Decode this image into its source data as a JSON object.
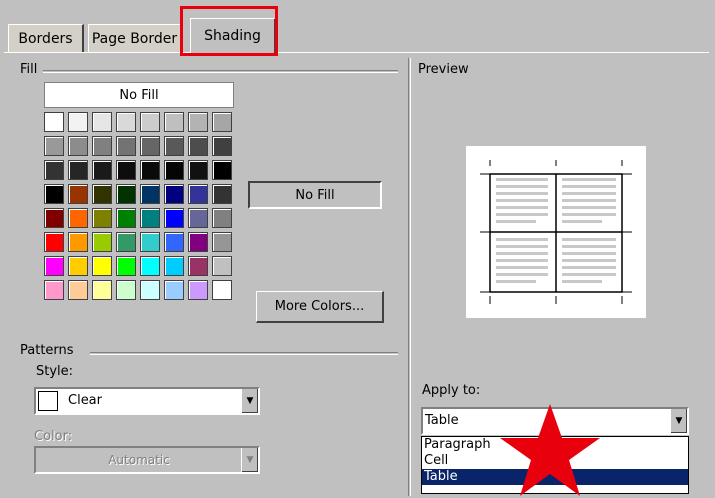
{
  "tabs": [
    {
      "label": "Borders",
      "active": false
    },
    {
      "label": "Page Border",
      "active": false
    },
    {
      "label": "Shading",
      "active": true
    }
  ],
  "fill": {
    "group_label": "Fill",
    "no_fill_label": "No Fill",
    "selected_name": "No Fill",
    "more_colors_label": "More Colors...",
    "swatches": [
      [
        "#ffffff",
        "#f2f2f2",
        "#e6e6e6",
        "#d9d9d9",
        "#cccccc",
        "#bfbfbf",
        "#b3b3b3",
        "#a6a6a6"
      ],
      [
        "#999999",
        "#8c8c8c",
        "#808080",
        "#737373",
        "#666666",
        "#595959",
        "#4d4d4d",
        "#404040"
      ],
      [
        "#333333",
        "#262626",
        "#1a1a1a",
        "#0d0d0d",
        "#0a0a0a",
        "#050505",
        "#111111",
        "#000000"
      ],
      [
        "#000000",
        "#993300",
        "#333300",
        "#003300",
        "#003366",
        "#000080",
        "#333399",
        "#333333"
      ],
      [
        "#800000",
        "#ff6600",
        "#808000",
        "#008000",
        "#008080",
        "#0000ff",
        "#666699",
        "#808080"
      ],
      [
        "#ff0000",
        "#ff9900",
        "#99cc00",
        "#339966",
        "#33cccc",
        "#3366ff",
        "#800080",
        "#969696"
      ],
      [
        "#ff00ff",
        "#ffcc00",
        "#ffff00",
        "#00ff00",
        "#00ffff",
        "#00ccff",
        "#993366",
        "#c0c0c0"
      ],
      [
        "#ff99cc",
        "#ffcc99",
        "#ffff99",
        "#ccffcc",
        "#ccffff",
        "#99ccff",
        "#cc99ff",
        "#ffffff"
      ]
    ]
  },
  "patterns": {
    "group_label": "Patterns",
    "style_label": "Style:",
    "style_value": "Clear",
    "color_label": "Color:",
    "color_value": "Automatic"
  },
  "preview": {
    "label": "Preview"
  },
  "apply_to": {
    "label": "Apply to:",
    "value": "Table",
    "options": [
      "Paragraph",
      "Cell",
      "Table"
    ],
    "selected_index": 2
  },
  "colors": {
    "dialog_bg": "#c0c0c0",
    "highlight": "#e8000d",
    "selection": "#0a246a"
  }
}
